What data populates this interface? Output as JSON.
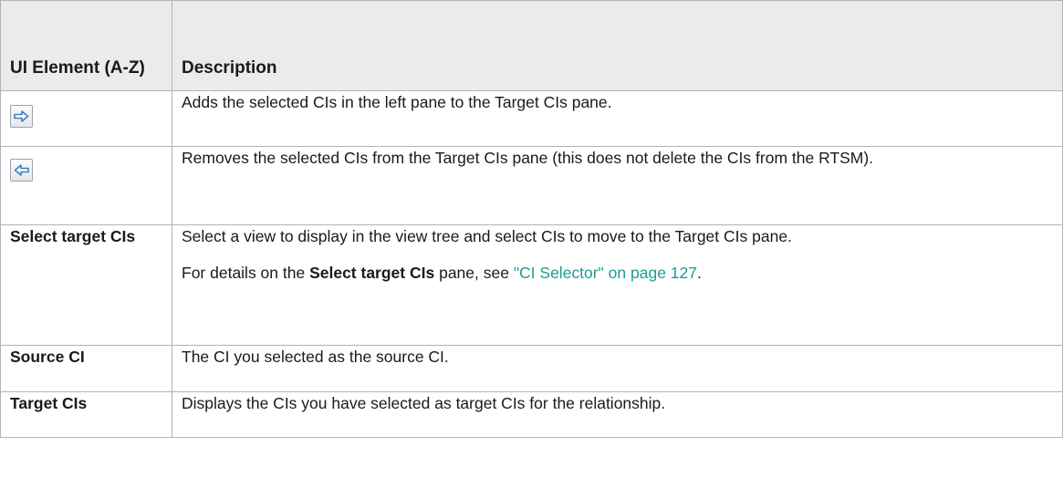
{
  "table": {
    "header": {
      "col1": "UI Element (A-Z)",
      "col2": "Description"
    },
    "rows": [
      {
        "element_icon": "arrow-right-icon",
        "description": "Adds the selected CIs in the left pane to the Target CIs pane."
      },
      {
        "element_icon": "arrow-left-icon",
        "description": "Removes the selected CIs from the Target CIs pane (this does not delete the CIs from the RTSM)."
      },
      {
        "element": "Select target CIs",
        "description": "Select a view to display in the view tree and select CIs to move to the Target CIs pane.",
        "details_prefix": "For details on the ",
        "details_bold": "Select target CIs",
        "details_mid": " pane, see ",
        "details_link": "\"CI Selector\" on page 127",
        "details_suffix": "."
      },
      {
        "element": "Source CI",
        "description": "The CI you selected as the source CI."
      },
      {
        "element": "Target CIs",
        "description": "Displays the CIs you have selected as target CIs for the relationship."
      }
    ]
  },
  "colors": {
    "header_bg": "#ebebeb",
    "border": "#b3b3b3",
    "link": "#1a9e8f",
    "icon_arrow": "#3d7fc4"
  }
}
